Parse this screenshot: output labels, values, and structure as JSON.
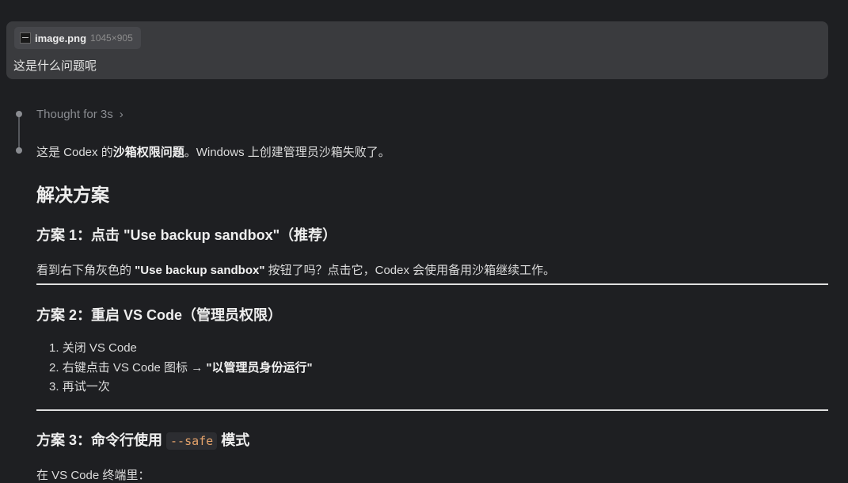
{
  "user_message": {
    "attachment": {
      "name": "image.png",
      "dims": "1045×905",
      "icon": "image-file-icon"
    },
    "text": "这是什么问题呢"
  },
  "thought": {
    "label": "Thought for 3s",
    "chevron": "›"
  },
  "answer": {
    "intro_pre": "这是 Codex 的",
    "intro_bold": "沙箱权限问题",
    "intro_post": "。Windows 上创建管理员沙箱失败了。",
    "heading": "解决方案",
    "option1": {
      "title": "方案 1：点击 \"Use backup sandbox\"（推荐）",
      "text_pre": "看到右下角灰色的 ",
      "text_bold": "\"Use backup sandbox\"",
      "text_post": " 按钮了吗？点击它，Codex 会使用备用沙箱继续工作。"
    },
    "option2": {
      "title": "方案 2：重启 VS Code（管理员权限）",
      "steps": [
        {
          "num": "1.",
          "text": "关闭 VS Code",
          "bold": ""
        },
        {
          "num": "2.",
          "text": "右键点击 VS Code 图标 → ",
          "bold": "\"以管理员身份运行\""
        },
        {
          "num": "3.",
          "text": "再试一次",
          "bold": ""
        }
      ]
    },
    "option3": {
      "title_pre": "方案 3：命令行使用 ",
      "code": "--safe",
      "title_post": " 模式",
      "text": "在 VS Code 终端里："
    }
  }
}
